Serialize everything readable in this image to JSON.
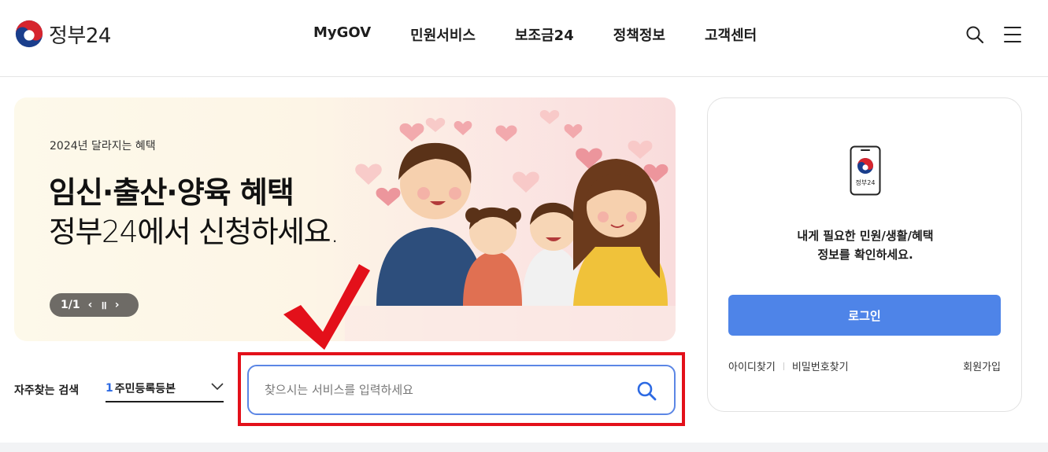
{
  "header": {
    "logo_text": "정부24",
    "nav": [
      "MyGOV",
      "민원서비스",
      "보조금24",
      "정책정보",
      "고객센터"
    ],
    "search_icon": "search-icon",
    "menu_icon": "hamburger-menu-icon"
  },
  "banner": {
    "subtitle": "2024년 달라지는 혜택",
    "title": "임신·출산·양육 혜택",
    "description": "정부24에서 신청하세요.",
    "pager": "1/1",
    "prev_icon": "‹",
    "pause_icon": "॥",
    "next_icon": "›"
  },
  "search": {
    "favorites_label": "자주찾는 검색",
    "favorite_rank": "1",
    "favorite_text": "주민등록등본",
    "placeholder": "찾으시는 서비스를 입력하세요"
  },
  "login": {
    "logo_caption": "정부24",
    "message_line1": "내게 필요한 민원/생활/혜택",
    "message_line2": "정보를 확인하세요.",
    "login_button": "로그인",
    "find_id": "아이디찾기",
    "find_password": "비밀번호찾기",
    "signup": "회원가입"
  },
  "colors": {
    "accent_blue": "#4e84e8",
    "highlight_red": "#e3101a",
    "search_border": "#5b86e5"
  }
}
